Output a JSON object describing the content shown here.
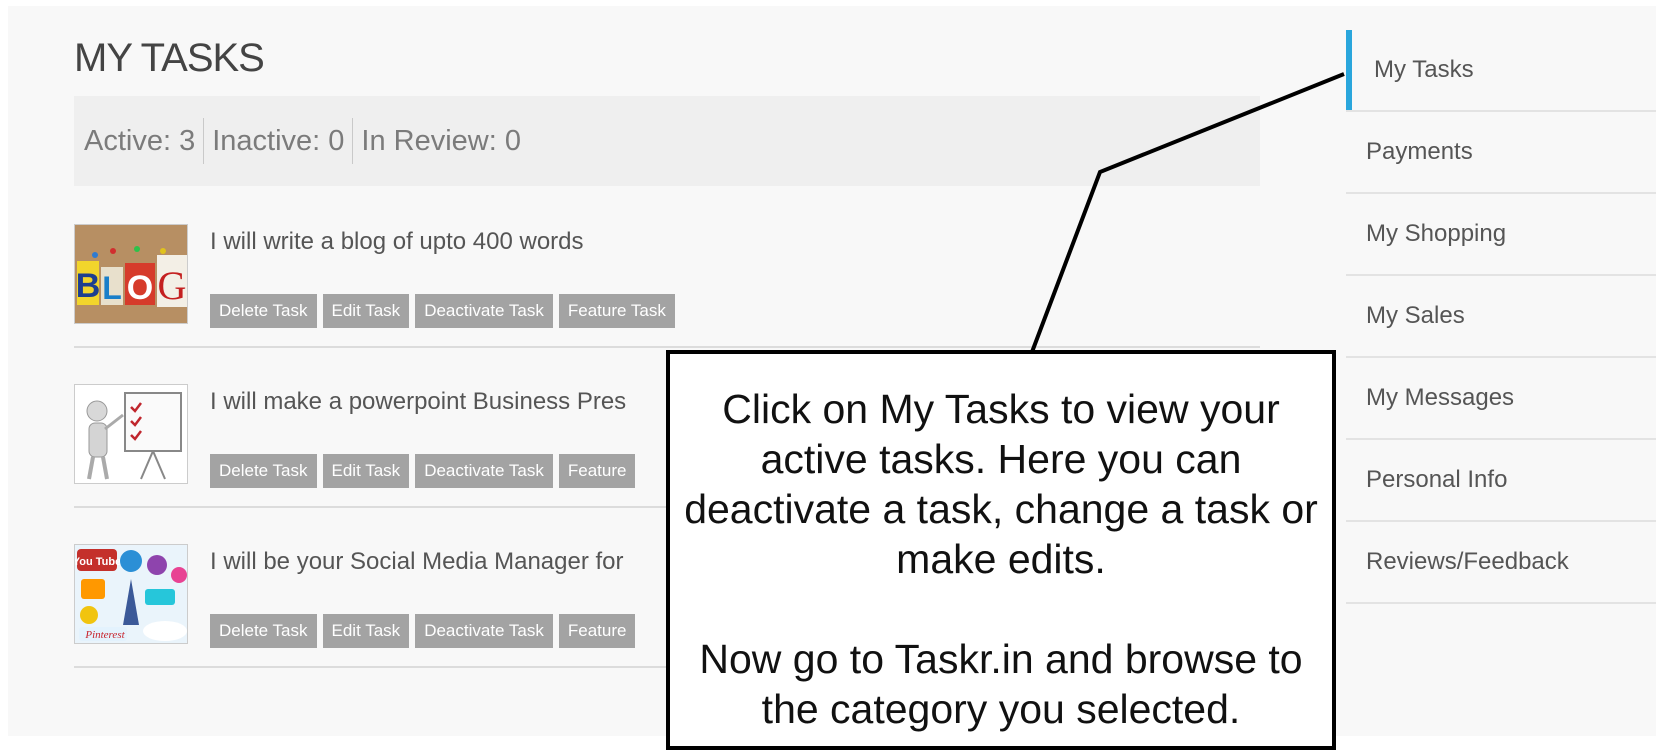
{
  "page": {
    "title": "MY TASKS"
  },
  "stats": [
    {
      "label": "Active: 3"
    },
    {
      "label": "Inactive: 0"
    },
    {
      "label": "In Review: 0"
    }
  ],
  "tasks": [
    {
      "title": "I will write a blog of upto 400 words",
      "thumb_text": "BLOG",
      "actions": [
        "Delete Task",
        "Edit Task",
        "Deactivate Task",
        "Feature Task"
      ]
    },
    {
      "title": "I will make a powerpoint Business Pres",
      "actions": [
        "Delete Task",
        "Edit Task",
        "Deactivate Task",
        "Feature"
      ]
    },
    {
      "title": "I will be your Social Media Manager for",
      "thumb_text": "You Tube",
      "actions": [
        "Delete Task",
        "Edit Task",
        "Deactivate Task",
        "Feature"
      ]
    }
  ],
  "sidebar": {
    "items": [
      {
        "label": "My Tasks",
        "active": true
      },
      {
        "label": "Payments"
      },
      {
        "label": "My Shopping"
      },
      {
        "label": "My Sales"
      },
      {
        "label": "My Messages"
      },
      {
        "label": "Personal Info"
      },
      {
        "label": "Reviews/Feedback"
      }
    ]
  },
  "callout": {
    "text1": "Click on My Tasks to view your active tasks. Here you can deactivate a task, change a task or make edits.",
    "text2": "Now go to Taskr.in and browse to the category you selected."
  },
  "colors": {
    "accent": "#2aa6dc",
    "button_bg": "#a3a3a3"
  }
}
